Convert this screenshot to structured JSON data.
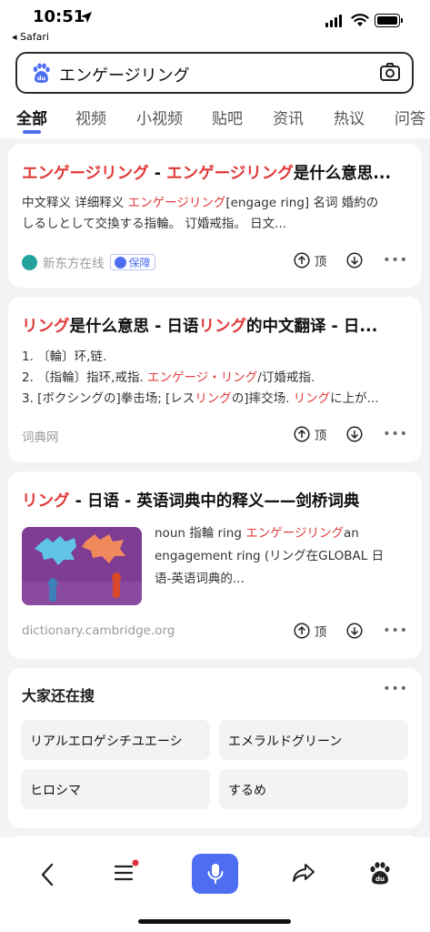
{
  "status": {
    "time": "10:51",
    "back_app": "◂ Safari"
  },
  "search": {
    "query": "エンゲージリング"
  },
  "tabs": [
    "全部",
    "视频",
    "小视频",
    "贴吧",
    "资讯",
    "热议",
    "问答"
  ],
  "results": [
    {
      "title_parts": [
        {
          "t": "エンゲージリング",
          "hl": true
        },
        {
          "t": " - ",
          "hl": false
        },
        {
          "t": "エンゲージリング",
          "hl": true
        },
        {
          "t": "是什么意思...",
          "hl": false
        }
      ],
      "desc_lines": [
        [
          {
            "t": "中文释义 详细释义 ",
            "hl": false
          },
          {
            "t": "エンゲージリング",
            "hl": true
          },
          {
            "t": "[engage ring] 名词 婚約の",
            "hl": false
          }
        ],
        [
          {
            "t": "しるしとして交換する指輪。 订婚戒指。 日文...",
            "hl": false
          }
        ]
      ],
      "source": "新东方在线",
      "badge": "保障",
      "up_label": "顶"
    },
    {
      "title_parts": [
        {
          "t": "リング",
          "hl": true
        },
        {
          "t": "是什么意思 - 日语",
          "hl": false
        },
        {
          "t": "リング",
          "hl": true
        },
        {
          "t": "的中文翻译 - 日...",
          "hl": false
        }
      ],
      "desc_lines": [
        [
          {
            "t": "1. 〔輪〕环,链.",
            "hl": false
          }
        ],
        [
          {
            "t": "2. 〔指輪〕指环,戒指. ",
            "hl": false
          },
          {
            "t": "エンゲージ・リング",
            "hl": true
          },
          {
            "t": "/订婚戒指.",
            "hl": false
          }
        ],
        [
          {
            "t": "3. [ボクシングの]拳击场; [レス",
            "hl": false
          },
          {
            "t": "リング",
            "hl": true
          },
          {
            "t": "の]摔交场. ",
            "hl": false
          },
          {
            "t": "リング",
            "hl": true
          },
          {
            "t": "に上が...",
            "hl": false
          }
        ]
      ],
      "source": "词典网",
      "up_label": "顶"
    },
    {
      "title_parts": [
        {
          "t": "リング",
          "hl": true
        },
        {
          "t": " - 日语 - 英语词典中的释义——剑桥词典",
          "hl": false
        }
      ],
      "desc_lines": [
        [
          {
            "t": "noun 指輪 ring ",
            "hl": false
          },
          {
            "t": "エンゲージリング",
            "hl": true
          },
          {
            "t": "an",
            "hl": false
          }
        ],
        [
          {
            "t": "engagement ring (リング在GLOBAL 日",
            "hl": false
          }
        ],
        [
          {
            "t": "语-英语词典的...",
            "hl": false
          }
        ]
      ],
      "source": "dictionary.cambridge.org",
      "up_label": "顶"
    }
  ],
  "related": {
    "title": "大家还在搜",
    "items": [
      "リアルエロゲシチユエーシ",
      "エメラルドグリーン",
      "ヒロシマ",
      "するめ"
    ]
  },
  "colors": {
    "accent": "#4e6ef2",
    "highlight": "#e03a3a"
  }
}
